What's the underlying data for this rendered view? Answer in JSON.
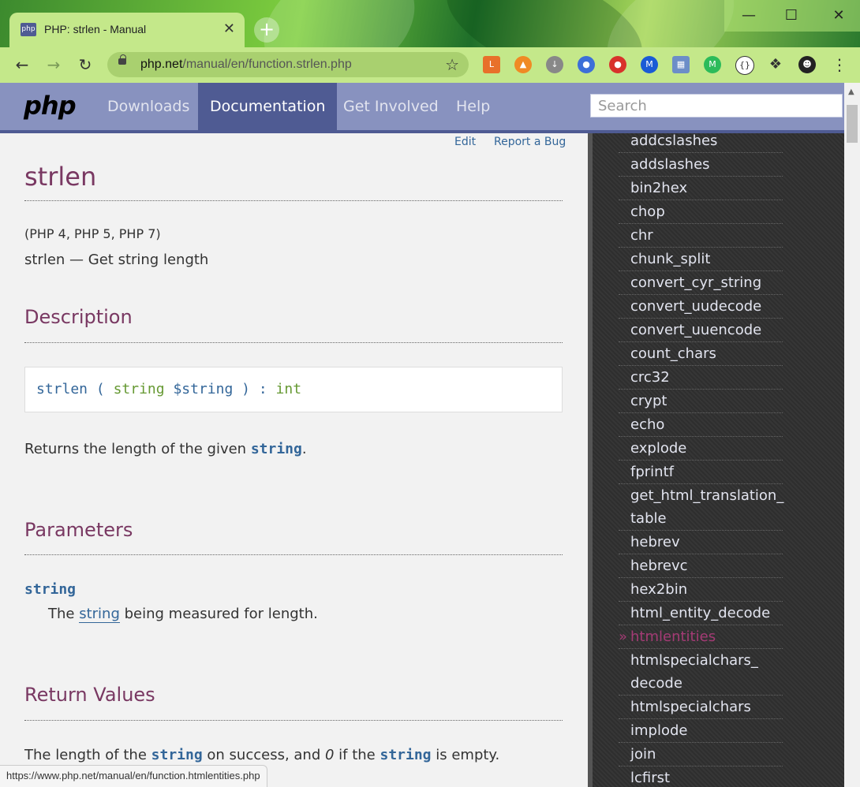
{
  "browser": {
    "tab_title": "PHP: strlen - Manual",
    "tab_favicon": "php",
    "url_host": "php.net",
    "url_path": "/manual/en/function.strlen.php",
    "status_url": "https://www.php.net/manual/en/function.htmlentities.php"
  },
  "header": {
    "logo": "php",
    "nav": [
      {
        "label": "Downloads",
        "active": false
      },
      {
        "label": "Documentation",
        "active": true
      },
      {
        "label": "Get Involved",
        "active": false
      },
      {
        "label": "Help",
        "active": false
      }
    ],
    "search_placeholder": "Search"
  },
  "page": {
    "edit_label": "Edit",
    "report_bug_label": "Report a Bug",
    "title": "strlen",
    "version": "(PHP 4, PHP 5, PHP 7)",
    "refname": "strlen — Get string length",
    "description_heading": "Description",
    "synopsis": {
      "name": "strlen",
      "open": "(",
      "param_type": "string",
      "param_name": "$string",
      "close": ")",
      "colon": ":",
      "return_type": "int"
    },
    "description_text_pre": "Returns the length of the given ",
    "description_text_code": "string",
    "description_text_post": ".",
    "parameters_heading": "Parameters",
    "param_term": "string",
    "param_def_pre": "The ",
    "param_def_link": "string",
    "param_def_post": " being measured for length.",
    "return_heading": "Return Values",
    "return_pre": "The length of the ",
    "return_code1": "string",
    "return_mid": " on success, and ",
    "return_zero": "0",
    "return_mid2": " if the ",
    "return_code2": "string",
    "return_post": " is empty."
  },
  "sidebar": {
    "current_marker": "»",
    "items": [
      "addcslashes",
      "addslashes",
      "bin2hex",
      "chop",
      "chr",
      "chunk_split",
      "convert_cyr_string",
      "convert_uudecode",
      "convert_uuencode",
      "count_chars",
      "crc32",
      "crypt",
      "echo",
      "explode",
      "fprintf",
      "get_html_translation_table",
      "hebrev",
      "hebrevc",
      "hex2bin",
      "html_entity_decode",
      "htmlentities",
      "htmlspecialchars_decode",
      "htmlspecialchars",
      "implode",
      "join",
      "lcfirst"
    ],
    "wrapped": {
      "get_html_translation_table": [
        "get_html_translation_",
        "table"
      ],
      "htmlspecialchars_decode": [
        "htmlspecialchars_",
        "decode"
      ]
    },
    "current": "htmlentities"
  },
  "colors": {
    "php_nav": "#8892bf",
    "php_nav_active": "#4f5b93",
    "heading": "#793862",
    "link": "#336699",
    "current_item": "#a43b75"
  }
}
